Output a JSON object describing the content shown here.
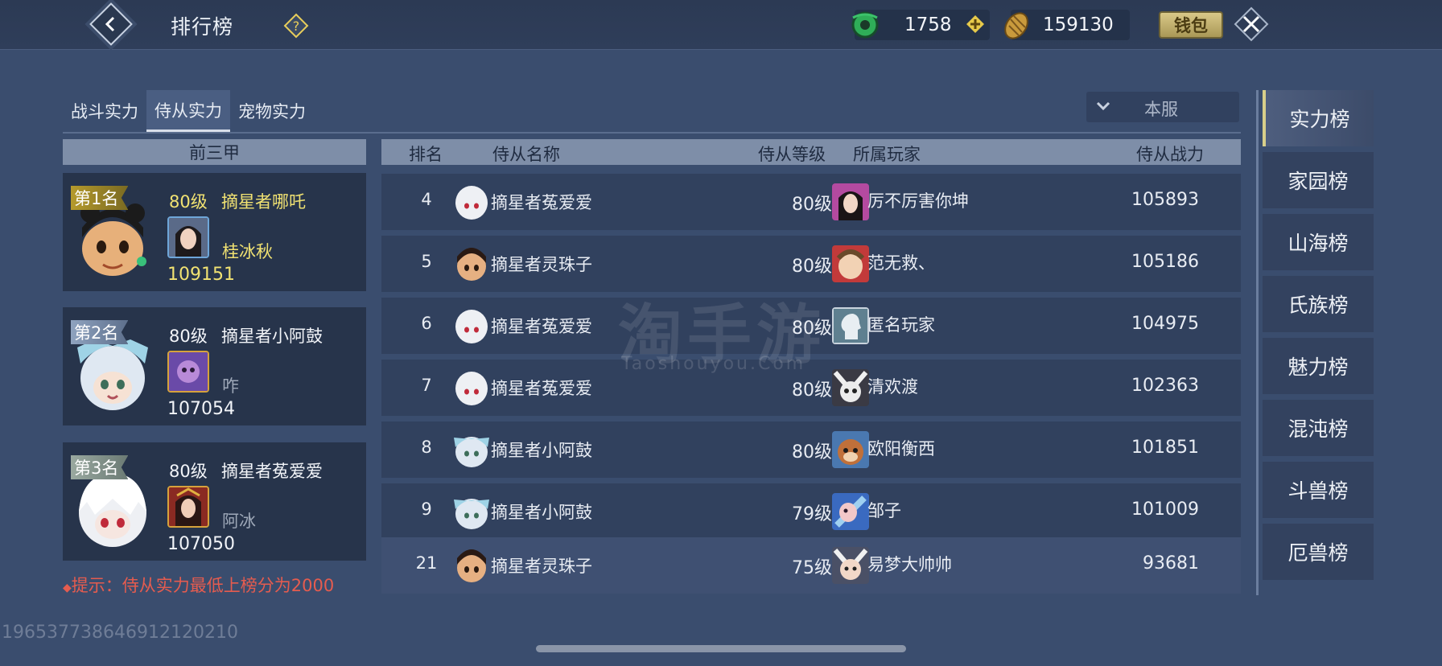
{
  "header": {
    "title": "排行榜",
    "jade_amount": "1758",
    "gold_amount": "159130",
    "wallet_label": "钱包"
  },
  "tabs": [
    {
      "label": "战斗实力",
      "active": false
    },
    {
      "label": "侍从实力",
      "active": true
    },
    {
      "label": "宠物实力",
      "active": false
    }
  ],
  "server_filter": "本服",
  "top_three": {
    "header": "前三甲",
    "entries": [
      {
        "rank_label": "第1名",
        "level": "80级",
        "pet_name": "摘星者哪吒",
        "owner": "桂冰秋",
        "power": "109151"
      },
      {
        "rank_label": "第2名",
        "level": "80级",
        "pet_name": "摘星者小阿鼓",
        "owner": "咋",
        "power": "107054"
      },
      {
        "rank_label": "第3名",
        "level": "80级",
        "pet_name": "摘星者菟爱爱",
        "owner": "阿冰",
        "power": "107050"
      }
    ]
  },
  "hint": "提示：侍从实力最低上榜分为2000",
  "table": {
    "columns": {
      "rank": "排名",
      "pet_name": "侍从名称",
      "pet_level": "侍从等级",
      "owner": "所属玩家",
      "power": "侍从战力"
    },
    "rows": [
      {
        "rank": "4",
        "pet_name": "摘星者菟爱爱",
        "level": "80级",
        "owner": "厉不厉害你坤",
        "power": "105893"
      },
      {
        "rank": "5",
        "pet_name": "摘星者灵珠子",
        "level": "80级",
        "owner": "范无救、",
        "power": "105186"
      },
      {
        "rank": "6",
        "pet_name": "摘星者菟爱爱",
        "level": "80级",
        "owner": "匿名玩家",
        "power": "104975"
      },
      {
        "rank": "7",
        "pet_name": "摘星者菟爱爱",
        "level": "80级",
        "owner": "清欢渡",
        "power": "102363"
      },
      {
        "rank": "8",
        "pet_name": "摘星者小阿鼓",
        "level": "80级",
        "owner": "欧阳衡西",
        "power": "101851"
      },
      {
        "rank": "9",
        "pet_name": "摘星者小阿鼓",
        "level": "79级",
        "owner": "邹子",
        "power": "101009"
      }
    ],
    "my_row": {
      "rank": "21",
      "pet_name": "摘星者灵珠子",
      "level": "75级",
      "owner": "易梦大帅帅",
      "power": "93681"
    }
  },
  "sidebar": [
    {
      "label": "实力榜",
      "active": true
    },
    {
      "label": "家园榜",
      "active": false
    },
    {
      "label": "山海榜",
      "active": false
    },
    {
      "label": "氏族榜",
      "active": false
    },
    {
      "label": "魅力榜",
      "active": false
    },
    {
      "label": "混沌榜",
      "active": false
    },
    {
      "label": "斗兽榜",
      "active": false
    },
    {
      "label": "厄兽榜",
      "active": false
    }
  ],
  "watermark": {
    "main": "淘手游",
    "sub": "Taoshouyou.Com"
  },
  "serial": "196537738646912120210"
}
